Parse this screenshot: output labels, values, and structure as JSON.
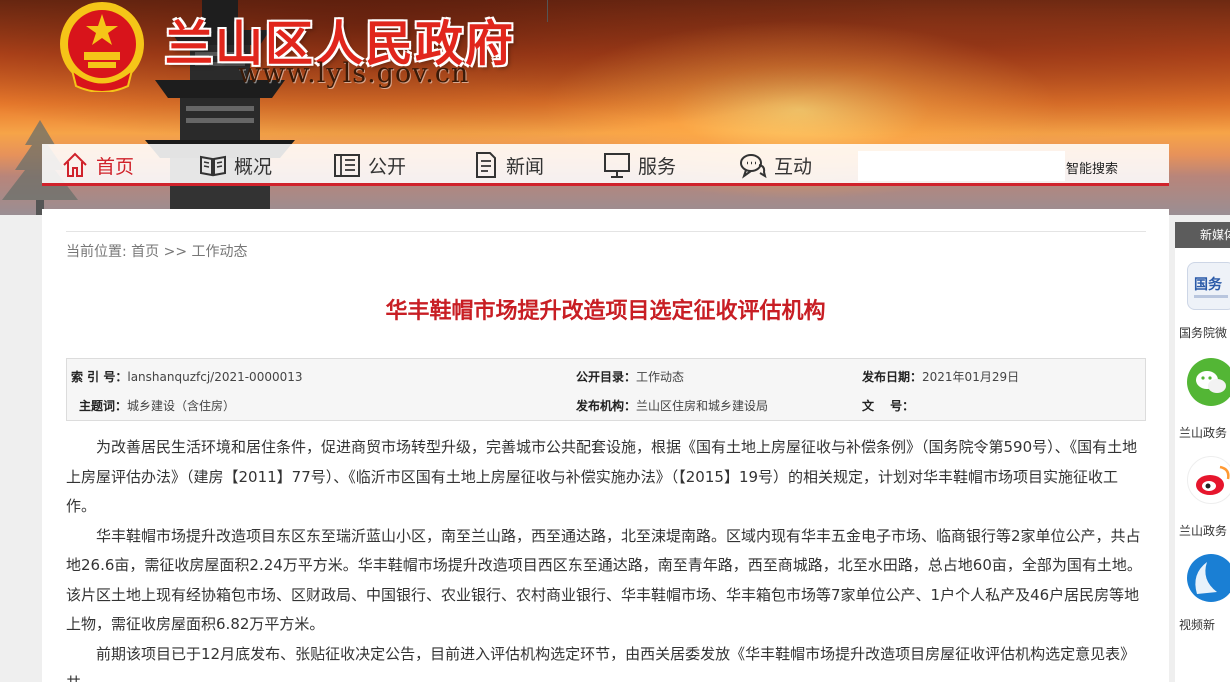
{
  "header": {
    "site_title": "兰山区人民政府",
    "site_url": "www.lyls.gov.cn"
  },
  "nav": {
    "items": [
      {
        "label": "首页",
        "icon": "home-icon",
        "active": true
      },
      {
        "label": "概况",
        "icon": "book-icon"
      },
      {
        "label": "公开",
        "icon": "document-list-icon"
      },
      {
        "label": "新闻",
        "icon": "news-icon"
      },
      {
        "label": "服务",
        "icon": "monitor-icon"
      },
      {
        "label": "互动",
        "icon": "chat-icon"
      }
    ],
    "search_placeholder": "",
    "search_button": "智能搜索"
  },
  "breadcrumb": "当前位置: 首页 >> 工作动态",
  "article": {
    "title": "华丰鞋帽市场提升改造项目选定征收评估机构",
    "meta": {
      "index_label": "索 引 号：",
      "index_value": "lanshanquzfcj/2021-0000013",
      "catalog_label": "公开目录：",
      "catalog_value": "工作动态",
      "date_label": "发布日期：",
      "date_value": "2021年01月29日",
      "topic_label": "主题词：",
      "topic_value": "城乡建设（含住房）",
      "org_label": "发布机构：",
      "org_value": "兰山区住房和城乡建设局",
      "docno_label": "文　 号：",
      "docno_value": ""
    },
    "paragraphs": [
      "为改善居民生活环境和居住条件，促进商贸市场转型升级，完善城市公共配套设施，根据《国有土地上房屋征收与补偿条例》（国务院令第590号）、《国有土地上房屋评估办法》（建房【2011】77号）、《临沂市区国有土地上房屋征收与补偿实施办法》（【2015】19号）的相关规定，计划对华丰鞋帽市场项目实施征收工作。",
      "华丰鞋帽市场提升改造项目东区东至瑞沂蓝山小区，南至兰山路，西至通达路，北至涑堤南路。区域内现有华丰五金电子市场、临商银行等2家单位公产，共占地26.6亩，需征收房屋面积2.24万平方米。华丰鞋帽市场提升改造项目西区东至通达路，南至青年路，西至商城路，北至水田路，总占地60亩，全部为国有土地。该片区土地上现有经协箱包市场、区财政局、中国银行、农业银行、农村商业银行、华丰鞋帽市场、华丰箱包市场等7家单位公产、1户个人私产及46户居民房等地上物，需征收房屋面积6.82万平方米。",
      "前期该项目已于12月底发布、张贴征收决定公告，目前进入评估机构选定环节，由西关居委发放《华丰鞋帽市场提升改造项目房屋征收评估机构选定意见表》共"
    ]
  },
  "side": {
    "header": "新媒体",
    "items": [
      {
        "label": "国务院微",
        "icon": "state-council-icon"
      },
      {
        "label": "兰山政务",
        "icon": "wechat-icon"
      },
      {
        "label": "兰山政务",
        "icon": "weibo-icon"
      },
      {
        "label": "视频新",
        "icon": "video-icon"
      }
    ]
  },
  "colors": {
    "accent": "#d0222b",
    "title_red": "#c81e24"
  }
}
